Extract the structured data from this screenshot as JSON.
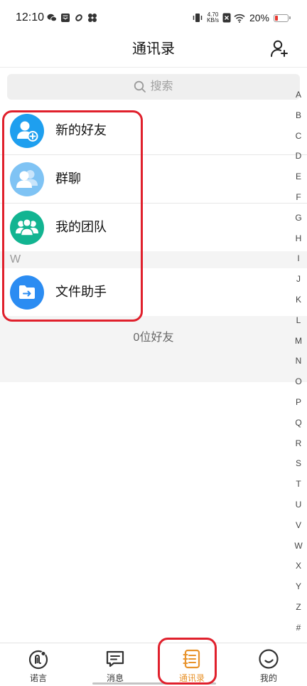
{
  "status_bar": {
    "time": "12:10",
    "net_speed": {
      "value": "4.70",
      "unit": "KB/s"
    },
    "battery_percent": "20%",
    "left_icons": [
      "wechat-icon",
      "inbox-icon",
      "link-icon",
      "clover-icon"
    ],
    "right_icons": [
      "vibrate-icon",
      "sim-x-icon",
      "wifi-icon",
      "battery-icon"
    ]
  },
  "header": {
    "title": "通讯录",
    "action_icon": "add-user-icon"
  },
  "search": {
    "placeholder": "搜索",
    "icon": "search-icon"
  },
  "contacts": {
    "items": [
      {
        "label": "新的好友",
        "icon": "new-friend-icon",
        "color": "#1e9fef"
      },
      {
        "label": "群聊",
        "icon": "group-chat-icon",
        "color": "#7fc3f4"
      },
      {
        "label": "我的团队",
        "icon": "team-icon",
        "color": "#12b491"
      }
    ],
    "sections": [
      {
        "letter": "W",
        "items": [
          {
            "label": "文件助手",
            "icon": "file-helper-icon",
            "color": "#2b8cf2"
          }
        ]
      }
    ],
    "footer": "0位好友"
  },
  "alphabet_index": [
    "A",
    "B",
    "C",
    "D",
    "E",
    "F",
    "G",
    "H",
    "I",
    "J",
    "K",
    "L",
    "M",
    "N",
    "O",
    "P",
    "Q",
    "R",
    "S",
    "T",
    "U",
    "V",
    "W",
    "X",
    "Y",
    "Z",
    "#"
  ],
  "tabs": [
    {
      "label": "诺言",
      "icon": "nuoyan-icon",
      "active": false
    },
    {
      "label": "消息",
      "icon": "message-icon",
      "active": false
    },
    {
      "label": "通讯录",
      "icon": "contacts-book-icon",
      "active": true
    },
    {
      "label": "我的",
      "icon": "profile-smile-icon",
      "active": false
    }
  ],
  "colors": {
    "accent": "#e8932c",
    "annotation": "#e0202c",
    "section_bg": "#f4f4f4"
  }
}
